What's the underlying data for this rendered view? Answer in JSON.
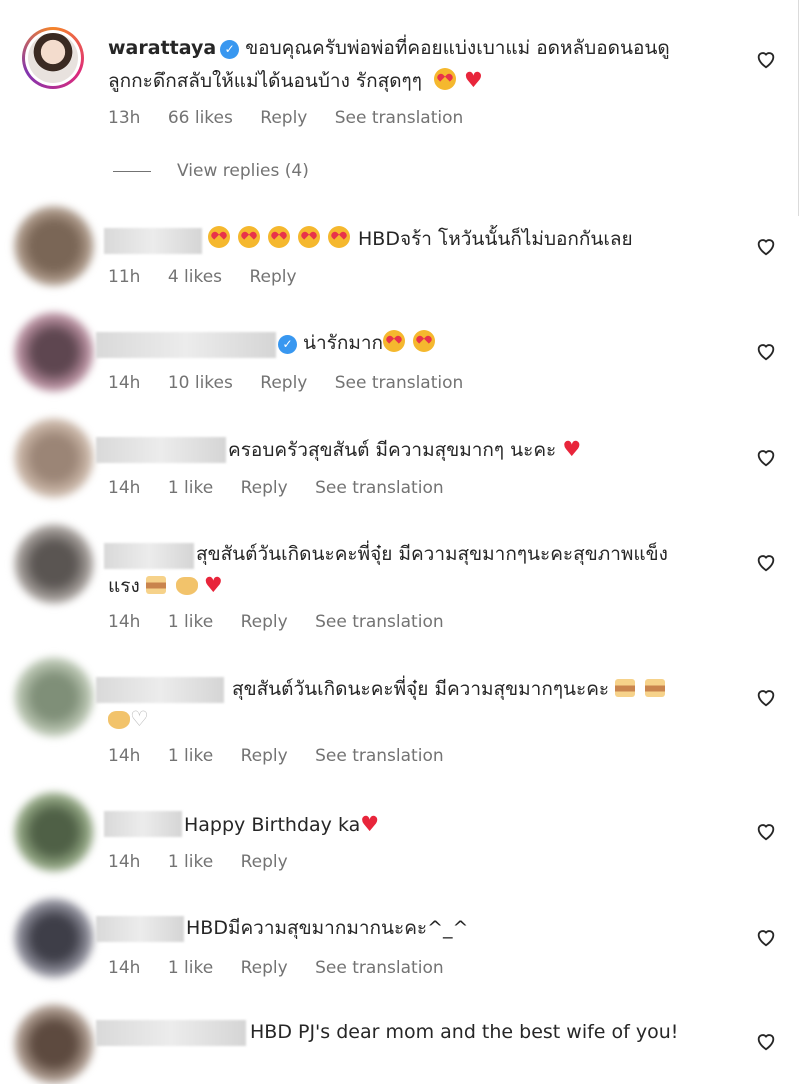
{
  "owner_comment": {
    "username": "warattaya",
    "text_line1": "ขอบคุณครับพ่อพ่อที่คอยแบ่งเบาแม่ อดหลับอดนอนดู",
    "text_line2": "ลูกกะดึกสลับให้แม่ได้นอนบ้าง รักสุดๆๆ",
    "time": "13h",
    "likes": "66 likes",
    "reply": "Reply",
    "see_translation": "See translation",
    "view_replies": "View replies (4)"
  },
  "comments": [
    {
      "text": "HBDจร้า โหวันนั้นก็ไม่บอกกันเลย",
      "time": "11h",
      "likes": "4 likes",
      "reply": "Reply"
    },
    {
      "text": "น่ารักมาก",
      "time": "14h",
      "likes": "10 likes",
      "reply": "Reply",
      "see_translation": "See translation"
    },
    {
      "text": "ครอบครัวสุขสันต์ มีความสุขมากๆ นะคะ",
      "time": "14h",
      "likes": "1 like",
      "reply": "Reply",
      "see_translation": "See translation"
    },
    {
      "text_line1": "สุขสันต์วันเกิดนะคะพี่จุ๋ย มีความสุขมากๆนะคะสุขภาพแข็ง",
      "text_line2": "แรง",
      "time": "14h",
      "likes": "1 like",
      "reply": "Reply",
      "see_translation": "See translation"
    },
    {
      "text": "สุขสันต์วันเกิดนะคะพี่จุ๋ย มีความสุขมากๆนะคะ",
      "time": "14h",
      "likes": "1 like",
      "reply": "Reply",
      "see_translation": "See translation"
    },
    {
      "text": "Happy Birthday ka",
      "time": "14h",
      "likes": "1 like",
      "reply": "Reply"
    },
    {
      "text": "HBDมีความสุขมากมากนะคะ^_^",
      "time": "14h",
      "likes": "1 like",
      "reply": "Reply",
      "see_translation": "See translation"
    },
    {
      "text": "HBD PJ's dear mom and the best wife of you!"
    }
  ],
  "colors": {
    "secondary_text": "#737373",
    "heart_red": "#e8253b",
    "verified_blue": "#3897f0"
  },
  "icons": [
    "heart-outline-icon",
    "verified-badge-icon"
  ]
}
